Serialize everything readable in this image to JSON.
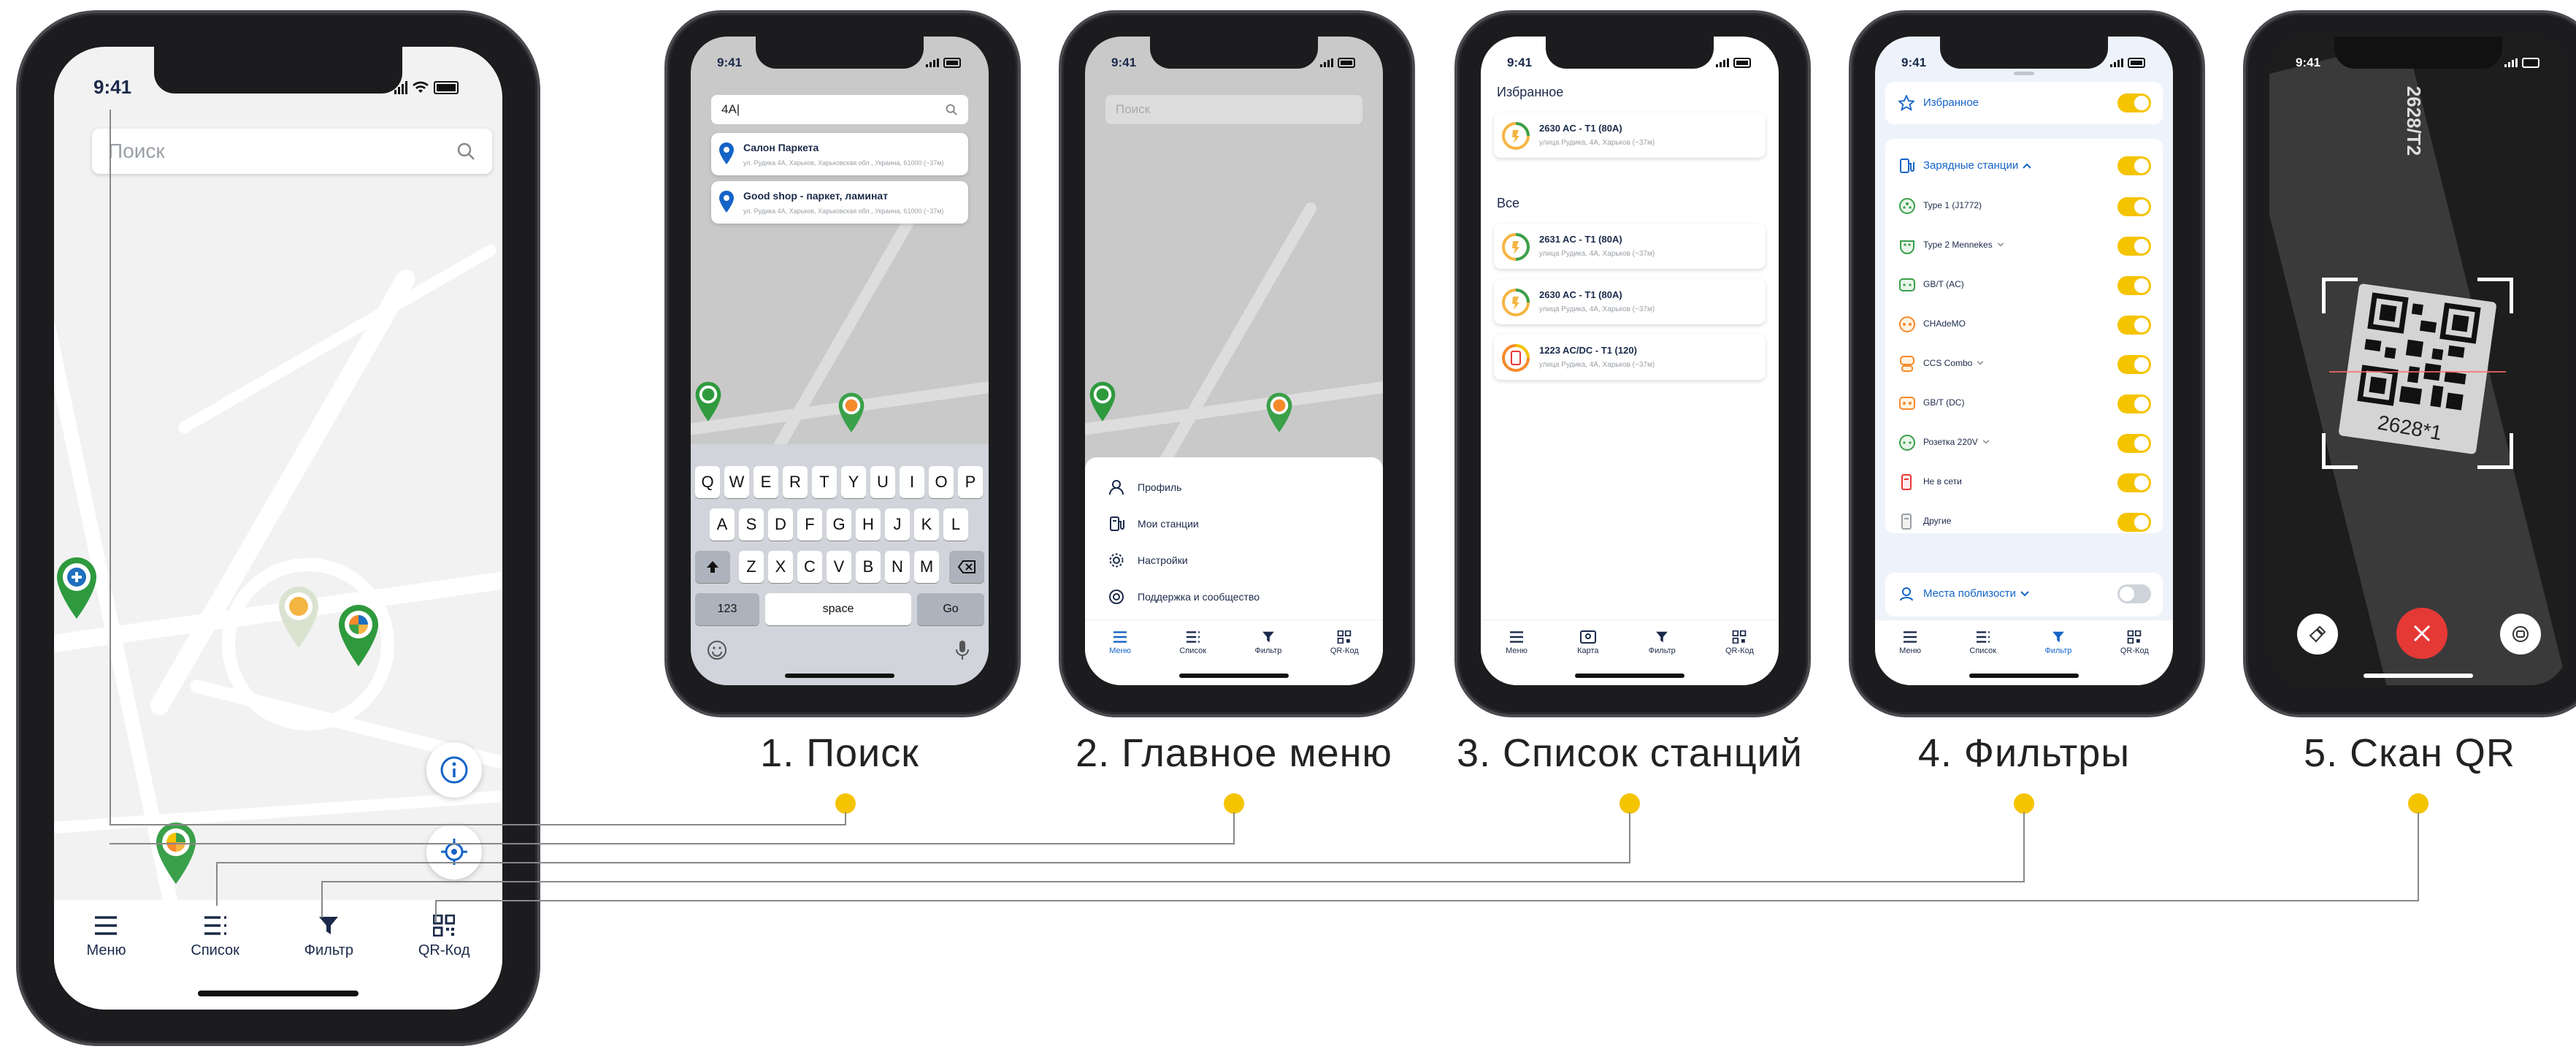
{
  "time": "9:41",
  "main_phone": {
    "search_placeholder": "Поиск",
    "tabs": [
      "Меню",
      "Список",
      "Фильтр",
      "QR-Код"
    ]
  },
  "search_screen": {
    "query": "4A|",
    "results": [
      {
        "title": "Салон Паркета",
        "address": "ул. Рудика 4А, Харьков, Харьковская обл., Украина, 61000 (~37м)"
      },
      {
        "title": "Good shop - паркет, ламинат",
        "address": "ул. Рудика 4А, Харьков, Харьковская обл., Украина, 61000 (~37м)"
      }
    ],
    "keyboard": {
      "row1": [
        "Q",
        "W",
        "E",
        "R",
        "T",
        "Y",
        "U",
        "I",
        "O",
        "P"
      ],
      "row2": [
        "A",
        "S",
        "D",
        "F",
        "G",
        "H",
        "J",
        "K",
        "L"
      ],
      "row3": [
        "Z",
        "X",
        "C",
        "V",
        "B",
        "N",
        "M"
      ],
      "numbers": "123",
      "space": "space",
      "go": "Go"
    }
  },
  "menu_screen": {
    "search_placeholder": "Поиск",
    "items": [
      "Профиль",
      "Мои станции",
      "Настройки",
      "Поддержка и сообщество"
    ],
    "tabs": [
      "Меню",
      "Список",
      "Фильтр",
      "QR-Код"
    ]
  },
  "list_screen": {
    "favorites_title": "Избранное",
    "favorites": [
      {
        "name": "2630 AC - T1 (80A)",
        "address": "улица Рудика, 4А, Харьков (~37м)"
      }
    ],
    "all_title": "Все",
    "all": [
      {
        "name": "2631 AC - T1 (80A)",
        "address": "улица Рудика, 4А, Харьков (~37м)"
      },
      {
        "name": "2630 AC - T1 (80A)",
        "address": "улица Рудика, 4А, Харьков (~37м)"
      },
      {
        "name": "1223 AC/DC - T1 (120)",
        "address": "улица Рудика, 4А, Харьков (~37м)"
      }
    ],
    "tabs": [
      "Меню",
      "Карта",
      "Фильтр",
      "QR-Код"
    ]
  },
  "filter_screen": {
    "favorites": "Избранное",
    "stations_header": "Зарядные станции",
    "items": [
      "Type 1 (J1772)",
      "Type 2 Mennekes",
      "GB/T (AC)",
      "CHAdeMO",
      "CCS Combo",
      "GB/T (DC)",
      "Розетка 220V",
      "Не в сети",
      "Другие"
    ],
    "nearby": "Места поблизости",
    "tabs": [
      "Меню",
      "Список",
      "Фильтр",
      "QR-Код"
    ]
  },
  "qr_screen": {
    "code_top": "2628/T2",
    "code_bottom": "2628*1"
  },
  "captions": [
    "1. Поиск",
    "2. Главное меню",
    "3. Список станций",
    "4. Фильтры",
    "5. Скан QR"
  ],
  "colors": {
    "accent": "#f5c400",
    "brand_blue": "#1463c7",
    "green": "#3aa04a",
    "red": "#e53935"
  }
}
